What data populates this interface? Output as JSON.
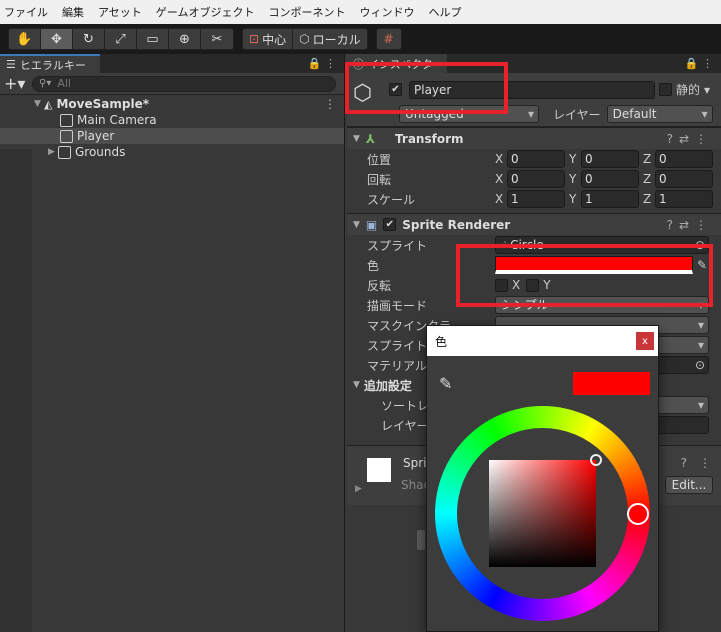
{
  "menu": [
    "ファイル",
    "編集",
    "アセット",
    "ゲームオブジェクト",
    "コンポーネント",
    "ウィンドウ",
    "ヘルプ"
  ],
  "toolbar": {
    "pivot": "中心",
    "space": "ローカル"
  },
  "hierarchy": {
    "tab": "ヒエラルキー",
    "search_placeholder": "All",
    "items": [
      {
        "label": "MoveSample*"
      },
      {
        "label": "Main Camera"
      },
      {
        "label": "Player"
      },
      {
        "label": "Grounds"
      }
    ]
  },
  "inspector": {
    "tab": "インスペクター",
    "name": "Player",
    "static_label": "静的",
    "tag_value": "Untagged",
    "layer_label": "レイヤー",
    "layer_value": "Default",
    "transform": {
      "title": "Transform",
      "rows": [
        {
          "label": "位置",
          "x": "0",
          "y": "0",
          "z": "0"
        },
        {
          "label": "回転",
          "x": "0",
          "y": "0",
          "z": "0"
        },
        {
          "label": "スケール",
          "x": "1",
          "y": "1",
          "z": "1"
        }
      ]
    },
    "sprite_renderer": {
      "title": "Sprite Renderer",
      "sprite_label": "スプライト",
      "sprite_value": "Circle",
      "color_label": "色",
      "flip_label": "反転",
      "flip_x": "X",
      "flip_y": "Y",
      "draw_mode_label": "描画モード",
      "draw_mode_value": "シンプル",
      "mask_label": "マスクインタラ",
      "sort_point_label": "スプライトソー",
      "material_label": "マテリアル",
      "additional_label": "追加設定",
      "sort_layer_label": "ソートレイ",
      "order_label": "レイヤーの"
    },
    "material_preview": {
      "name": "Spri",
      "shader": "Shad",
      "edit": "Edit..."
    }
  },
  "color_picker": {
    "title": "色",
    "close": "x",
    "current_color": "#ff0000"
  },
  "axes": {
    "x": "X",
    "y": "Y",
    "z": "Z"
  }
}
